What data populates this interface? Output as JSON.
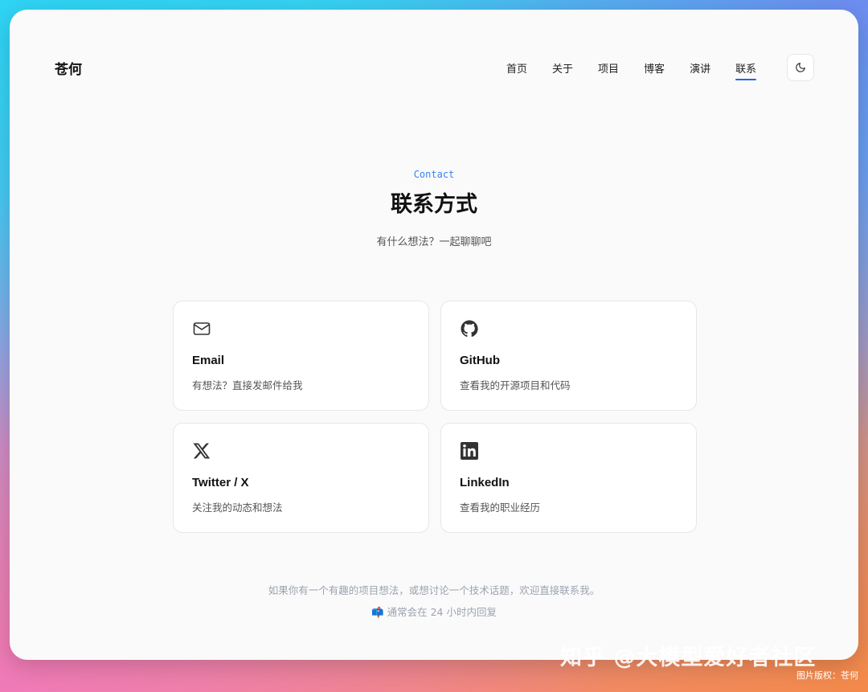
{
  "header": {
    "brand": "苍何",
    "nav": [
      "首页",
      "关于",
      "项目",
      "博客",
      "演讲",
      "联系"
    ],
    "active_nav": "联系",
    "theme_icon": "moon-icon"
  },
  "hero": {
    "eyebrow": "Contact",
    "title": "联系方式",
    "subtitle": "有什么想法？一起聊聊吧"
  },
  "cards": [
    {
      "icon": "mail-icon",
      "title": "Email",
      "desc": "有想法？直接发邮件给我"
    },
    {
      "icon": "github-icon",
      "title": "GitHub",
      "desc": "查看我的开源项目和代码"
    },
    {
      "icon": "x-twitter-icon",
      "title": "Twitter / X",
      "desc": "关注我的动态和想法"
    },
    {
      "icon": "linkedin-icon",
      "title": "LinkedIn",
      "desc": "查看我的职业经历"
    }
  ],
  "footer": {
    "line1": "如果你有一个有趣的项目想法，或想讨论一个技术话题，欢迎直接联系我。",
    "line2_icon": "📫",
    "line2": "通常会在 24 小时内回复"
  },
  "overlay": {
    "watermark": "知乎 @大模型爱好者社区",
    "credit": "图片版权：苍何"
  },
  "colors": {
    "accent": "#2563eb",
    "eyebrow": "#3b82f6",
    "text": "#111111",
    "muted": "#9ca3af"
  }
}
